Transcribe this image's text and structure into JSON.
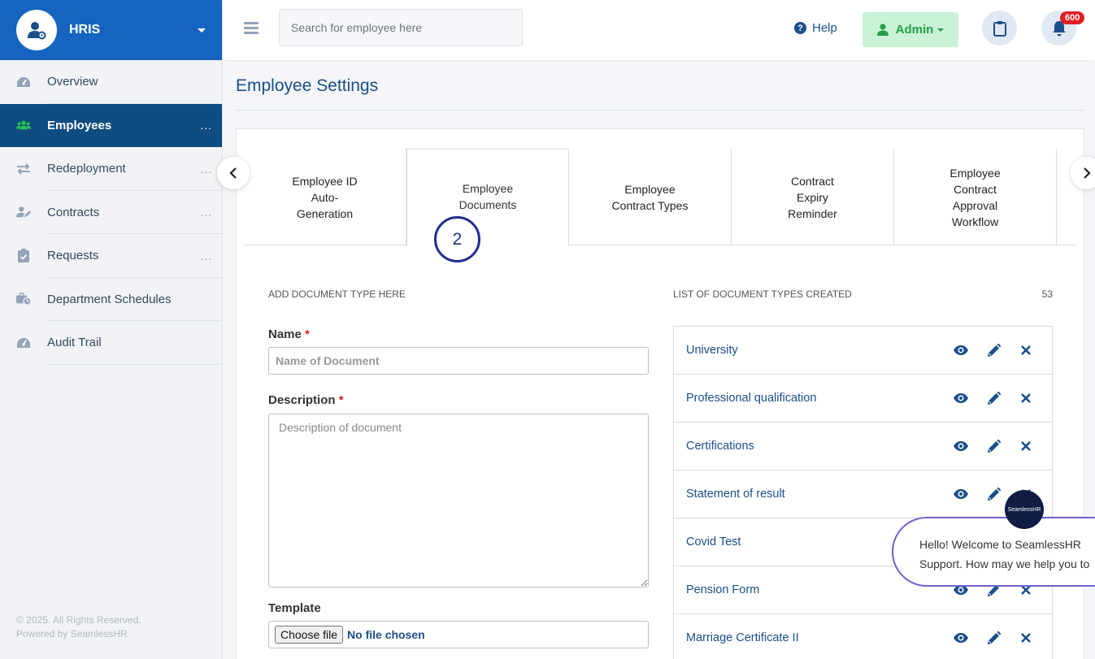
{
  "brand": {
    "name": "HRIS"
  },
  "sidebar": {
    "items": [
      {
        "label": "Overview",
        "icon": "dashboard-icon",
        "dots": ""
      },
      {
        "label": "Employees",
        "icon": "users-icon",
        "dots": "...",
        "active": true
      },
      {
        "label": "Redeployment",
        "icon": "transfer-icon",
        "dots": "..."
      },
      {
        "label": "Contracts",
        "icon": "user-edit-icon",
        "dots": "..."
      },
      {
        "label": "Requests",
        "icon": "clipboard-check-icon",
        "dots": "..."
      },
      {
        "label": "Department Schedules",
        "icon": "briefcase-clock-icon",
        "dots": ""
      },
      {
        "label": "Audit Trail",
        "icon": "dashboard-icon",
        "dots": ""
      }
    ],
    "footer": {
      "copyright": "© 2025. All Rights Reserved.",
      "powered": "Powered by SeamlessHR"
    }
  },
  "topbar": {
    "search_placeholder": "Search for employee here",
    "help_label": "Help",
    "admin_label": "Admin",
    "notification_count": "600"
  },
  "page": {
    "title": "Employee Settings"
  },
  "tabs": [
    {
      "label": "Employee ID Auto-Generation",
      "lines": [
        "Employee ID",
        "Auto-",
        "Generation"
      ]
    },
    {
      "label": "Employee Documents",
      "lines": [
        "Employee",
        "Documents"
      ],
      "active": true
    },
    {
      "label": "Employee Contract Types",
      "lines": [
        "Employee",
        "Contract Types"
      ]
    },
    {
      "label": "Contract Expiry Reminder",
      "lines": [
        "Contract",
        "Expiry",
        "Reminder"
      ]
    },
    {
      "label": "Employee Contract Approval Workflow",
      "lines": [
        "Employee",
        "Contract",
        "Approval",
        "Workflow"
      ]
    }
  ],
  "step_marker": "2",
  "form": {
    "section_title": "ADD DOCUMENT TYPE HERE",
    "name_label": "Name",
    "name_placeholder": "Name of Document",
    "description_label": "Description",
    "description_placeholder": "Description of document",
    "template_label": "Template",
    "choose_file": "Choose file",
    "no_file": "No file chosen",
    "required_mark": "*"
  },
  "list": {
    "section_title": "LIST OF DOCUMENT TYPES CREATED",
    "count": "53",
    "items": [
      "University",
      "Professional qualification",
      "Certifications",
      "Statement of result",
      "Covid Test",
      "Pension Form",
      "Marriage Certificate II"
    ]
  },
  "chat": {
    "avatar_text": "SeamlessHR",
    "line1": "Hello! Welcome to SeamlessHR",
    "line2": "Support. How may we help you to"
  },
  "colors": {
    "brand_blue": "#1565c0",
    "active_nav": "#0f4c81",
    "link_blue": "#1a4e8a",
    "admin_green": "#20a047",
    "badge_red": "#e31c23"
  }
}
